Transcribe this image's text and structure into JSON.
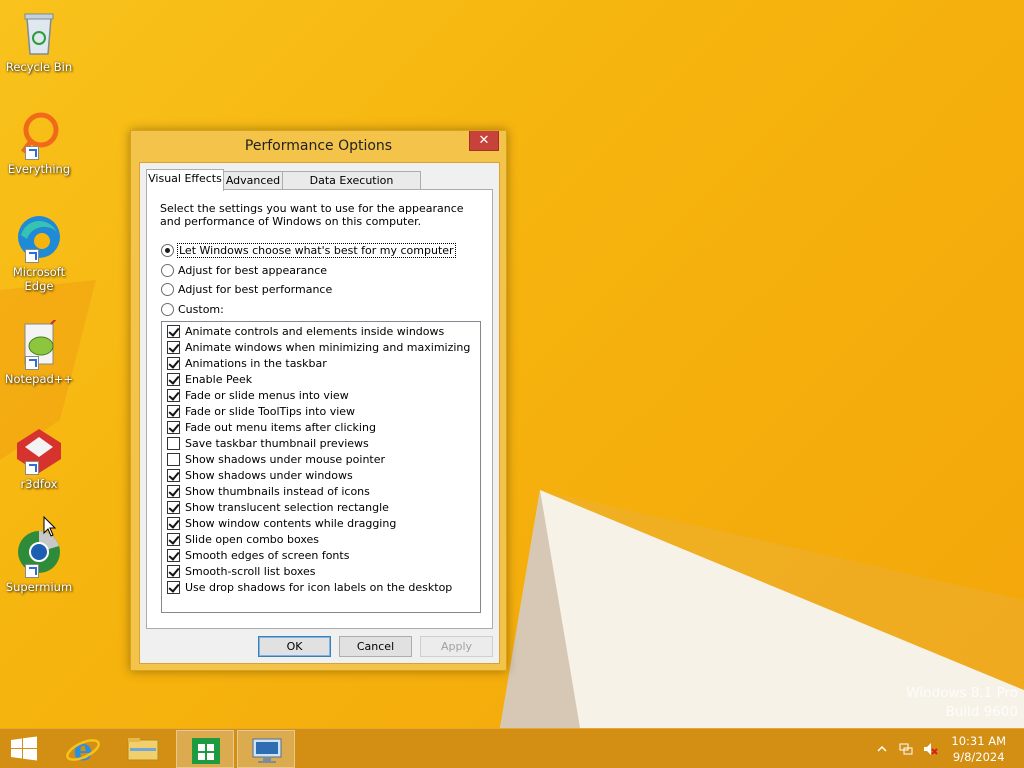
{
  "desktop": {
    "icons": [
      {
        "label": "Recycle Bin",
        "icon": "recycle-bin-icon"
      },
      {
        "label": "Everything",
        "icon": "everything-icon"
      },
      {
        "label": "Microsoft Edge",
        "icon": "edge-icon"
      },
      {
        "label": "Notepad++",
        "icon": "notepad-plus-plus-icon"
      },
      {
        "label": "r3dfox",
        "icon": "r3dfox-icon"
      },
      {
        "label": "Supermium",
        "icon": "supermium-icon"
      }
    ],
    "watermark": {
      "line1": "Windows 8.1 Pro",
      "line2": "Build 9600"
    }
  },
  "dialog": {
    "title": "Performance Options",
    "close_label": "✕",
    "tabs": [
      {
        "label": "Visual Effects",
        "active": true
      },
      {
        "label": "Advanced",
        "active": false
      },
      {
        "label": "Data Execution Prevention",
        "active": false
      }
    ],
    "intro": "Select the settings you want to use for the appearance and performance of Windows on this computer.",
    "radios": [
      {
        "label": "Let Windows choose what's best for my computer",
        "checked": true
      },
      {
        "label": "Adjust for best appearance",
        "checked": false
      },
      {
        "label": "Adjust for best performance",
        "checked": false
      },
      {
        "label": "Custom:",
        "checked": false
      }
    ],
    "effects": [
      {
        "label": "Animate controls and elements inside windows",
        "checked": true
      },
      {
        "label": "Animate windows when minimizing and maximizing",
        "checked": true
      },
      {
        "label": "Animations in the taskbar",
        "checked": true
      },
      {
        "label": "Enable Peek",
        "checked": true
      },
      {
        "label": "Fade or slide menus into view",
        "checked": true
      },
      {
        "label": "Fade or slide ToolTips into view",
        "checked": true
      },
      {
        "label": "Fade out menu items after clicking",
        "checked": true
      },
      {
        "label": "Save taskbar thumbnail previews",
        "checked": false
      },
      {
        "label": "Show shadows under mouse pointer",
        "checked": false
      },
      {
        "label": "Show shadows under windows",
        "checked": true
      },
      {
        "label": "Show thumbnails instead of icons",
        "checked": true
      },
      {
        "label": "Show translucent selection rectangle",
        "checked": true
      },
      {
        "label": "Show window contents while dragging",
        "checked": true
      },
      {
        "label": "Slide open combo boxes",
        "checked": true
      },
      {
        "label": "Smooth edges of screen fonts",
        "checked": true
      },
      {
        "label": "Smooth-scroll list boxes",
        "checked": true
      },
      {
        "label": "Use drop shadows for icon labels on the desktop",
        "checked": true
      }
    ],
    "buttons": {
      "ok": "OK",
      "cancel": "Cancel",
      "apply": "Apply"
    }
  },
  "taskbar": {
    "items": [
      {
        "icon": "start-icon"
      },
      {
        "icon": "internet-explorer-icon"
      },
      {
        "icon": "file-explorer-icon"
      },
      {
        "icon": "store-icon"
      },
      {
        "icon": "system-properties-icon"
      }
    ],
    "clock": {
      "time": "10:31 AM",
      "date": "9/8/2024"
    }
  },
  "colors": {
    "accent": "#f6b40e",
    "close": "#c7423a",
    "taskbar": "#d28f14"
  }
}
